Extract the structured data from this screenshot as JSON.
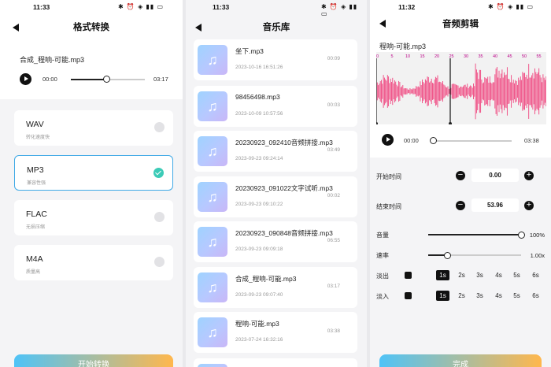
{
  "panel1": {
    "time": "11:33",
    "title": "格式转换",
    "file_name": "合成_程响-可能.mp3",
    "current_time": "00:00",
    "duration": "03:17",
    "progress": 0.48,
    "formats": [
      {
        "name": "WAV",
        "desc": "转化速度快",
        "selected": false
      },
      {
        "name": "MP3",
        "desc": "兼容性强",
        "selected": true
      },
      {
        "name": "FLAC",
        "desc": "无损压缩",
        "selected": false
      },
      {
        "name": "M4A",
        "desc": "质量高",
        "selected": false
      }
    ],
    "start_button": "开始转换"
  },
  "panel2": {
    "time": "11:33",
    "title": "音乐库",
    "items": [
      {
        "name": "坐下.mp3",
        "date": "2023-10-16 16:51:26",
        "duration": "00:09"
      },
      {
        "name": "98456498.mp3",
        "date": "2023-10-09 10:57:56",
        "duration": "00:03"
      },
      {
        "name": "20230923_092410音频拼接.mp3",
        "date": "2023-09-23 09:24:14",
        "duration": "03:49"
      },
      {
        "name": "20230923_091022文字试听.mp3",
        "date": "2023-09-23 09:10:22",
        "duration": "00:02"
      },
      {
        "name": "20230923_090848音频拼接.mp3",
        "date": "2023-09-23 09:09:18",
        "duration": "06:55"
      },
      {
        "name": "合成_程响-可能.mp3",
        "date": "2023-09-23 09:07:40",
        "duration": "03:17"
      },
      {
        "name": "程响-可能.mp3",
        "date": "2023-07-24 16:32:16",
        "duration": "03:38"
      }
    ]
  },
  "panel3": {
    "time": "11:32",
    "title": "音频剪辑",
    "file_name": "程响-可能.mp3",
    "ruler_labels": [
      "0",
      "5",
      "10",
      "15",
      "20",
      "25",
      "30",
      "35",
      "40",
      "45",
      "50",
      "55"
    ],
    "current_time": "00:00",
    "duration": "03:38",
    "progress": 0.0,
    "start_label": "开始时间",
    "start_value": "0.00",
    "end_label": "结束时间",
    "end_value": "53.96",
    "volume_label": "音量",
    "volume_value": "100%",
    "volume_level": 1.0,
    "speed_label": "速率",
    "speed_value": "1.00x",
    "speed_level": 0.2,
    "fade_out_label": "淡出",
    "fade_in_label": "淡入",
    "fade_options": [
      "1s",
      "2s",
      "3s",
      "4s",
      "5s",
      "6s"
    ],
    "fade_out_selected": "1s",
    "fade_in_selected": "1s",
    "done_button": "完成"
  },
  "status_icons": "✱ ⏰ ◈ ▮▮ ▭",
  "colors": {
    "accent_blue": "#3fa9e6",
    "check_green": "#3ccbb7",
    "wave_pink": "#f0457f",
    "btn_gradient_start": "#4fc3f7",
    "btn_gradient_end": "#ffb74d"
  }
}
